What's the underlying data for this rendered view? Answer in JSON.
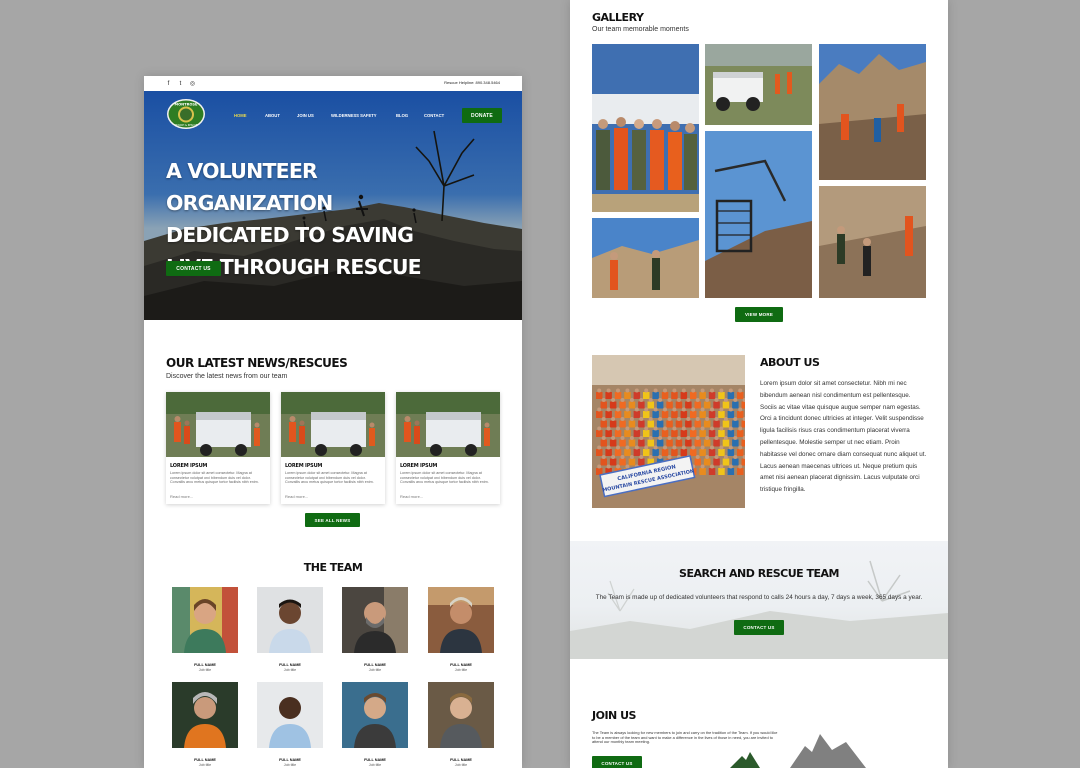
{
  "topbar": {
    "social": [
      {
        "icon": "facebook-icon",
        "glyph": "f"
      },
      {
        "icon": "twitter-icon",
        "glyph": "t"
      },
      {
        "icon": "instagram-icon",
        "glyph": "◎"
      }
    ],
    "helpline": "Rescue Helpline: 890.348.5464"
  },
  "nav": {
    "items": [
      "HOME",
      "ABOUT",
      "JOIN US",
      "WILDERNESS SAFETY",
      "BLOG",
      "CONTACT"
    ],
    "donate": "DONATE",
    "active": "HOME"
  },
  "hero": {
    "title": "A VOLUNTEER ORGANIZATION DEDICATED TO SAVING LIVE THROUGH RESCUE",
    "cta": "CONTACT US"
  },
  "news": {
    "title": "OUR LATEST NEWS/RESCUES",
    "subtitle": "Discover the latest news from our team",
    "cards": [
      {
        "title": "LOREM IPSUM",
        "text": "Lorem ipsum dolor sit amet consectetur. Magna at consectetur volutpat orci bibendum duis vel dolor. Convallis arcu metus quisque tortor facilisis nibh enim.",
        "more": "Read more..."
      },
      {
        "title": "LOREM IPSUM",
        "text": "Lorem ipsum dolor sit amet consectetur. Magna at consectetur volutpat orci bibendum duis vel dolor. Convallis arcu metus quisque tortor facilisis nibh enim.",
        "more": "Read more..."
      },
      {
        "title": "LOREM IPSUM",
        "text": "Lorem ipsum dolor sit amet consectetur. Magna at consectetur volutpat orci bibendum duis vel dolor. Convallis arcu metus quisque tortor facilisis nibh enim.",
        "more": "Read more..."
      }
    ],
    "see_all": "SEE ALL NEWS"
  },
  "team": {
    "title": "THE TEAM",
    "members": [
      {
        "name": "FULL NAME",
        "job": "Job title"
      },
      {
        "name": "FULL NAME",
        "job": "Job title"
      },
      {
        "name": "FULL NAME",
        "job": "Job title"
      },
      {
        "name": "FULL NAME",
        "job": "Job title"
      },
      {
        "name": "FULL NAME",
        "job": "Job title"
      },
      {
        "name": "FULL NAME",
        "job": "Job title"
      },
      {
        "name": "FULL NAME",
        "job": "Job title"
      },
      {
        "name": "FULL NAME",
        "job": "Job title"
      }
    ]
  },
  "gallery": {
    "title": "GALLERY",
    "subtitle": "Our team memorable moments",
    "view_more": "VIEW MORE"
  },
  "about": {
    "title": "ABOUT US",
    "text": "Lorem ipsum dolor sit amet consectetur. Nibh mi nec bibendum aenean nisl condimentum est pellentesque. Sociis ac vitae vitae quisque augue semper nam egestas. Orci a tincidunt donec ultricies at integer. Velit suspendisse ligula facilisis risus cras condimentum placerat viverra pellentesque. Molestie semper ut nec etiam. Proin habitasse vel donec ornare diam consequat nunc aliquet ut. Lacus aenean maecenas ultrices ut. Neque pretium quis amet nisi aenean placerat dignissim. Lacus vulputate orci tristique fringilla.",
    "banner": "CALIFORNIA REGION MOUNTAIN RESCUE ASSOCIATION"
  },
  "search_rescue": {
    "title": "SEARCH AND RESCUE TEAM",
    "text": "The Team is made up of dedicated volunteers that respond to calls 24 hours a day, 7 days a week, 365 days a year.",
    "cta": "CONTACT US"
  },
  "join": {
    "title": "JOIN US",
    "text": "The Team is always looking for new members to join and carry on the tradition of the Team. If you would like to be a member of the team and want to make a difference in the lives of those in need, you are invited to attend our monthly team meeting.",
    "cta": "CONTACT US"
  },
  "colors": {
    "accent_green": "#0f6b12",
    "nav_active": "#e9d94d",
    "background": "#a6a6a6"
  }
}
